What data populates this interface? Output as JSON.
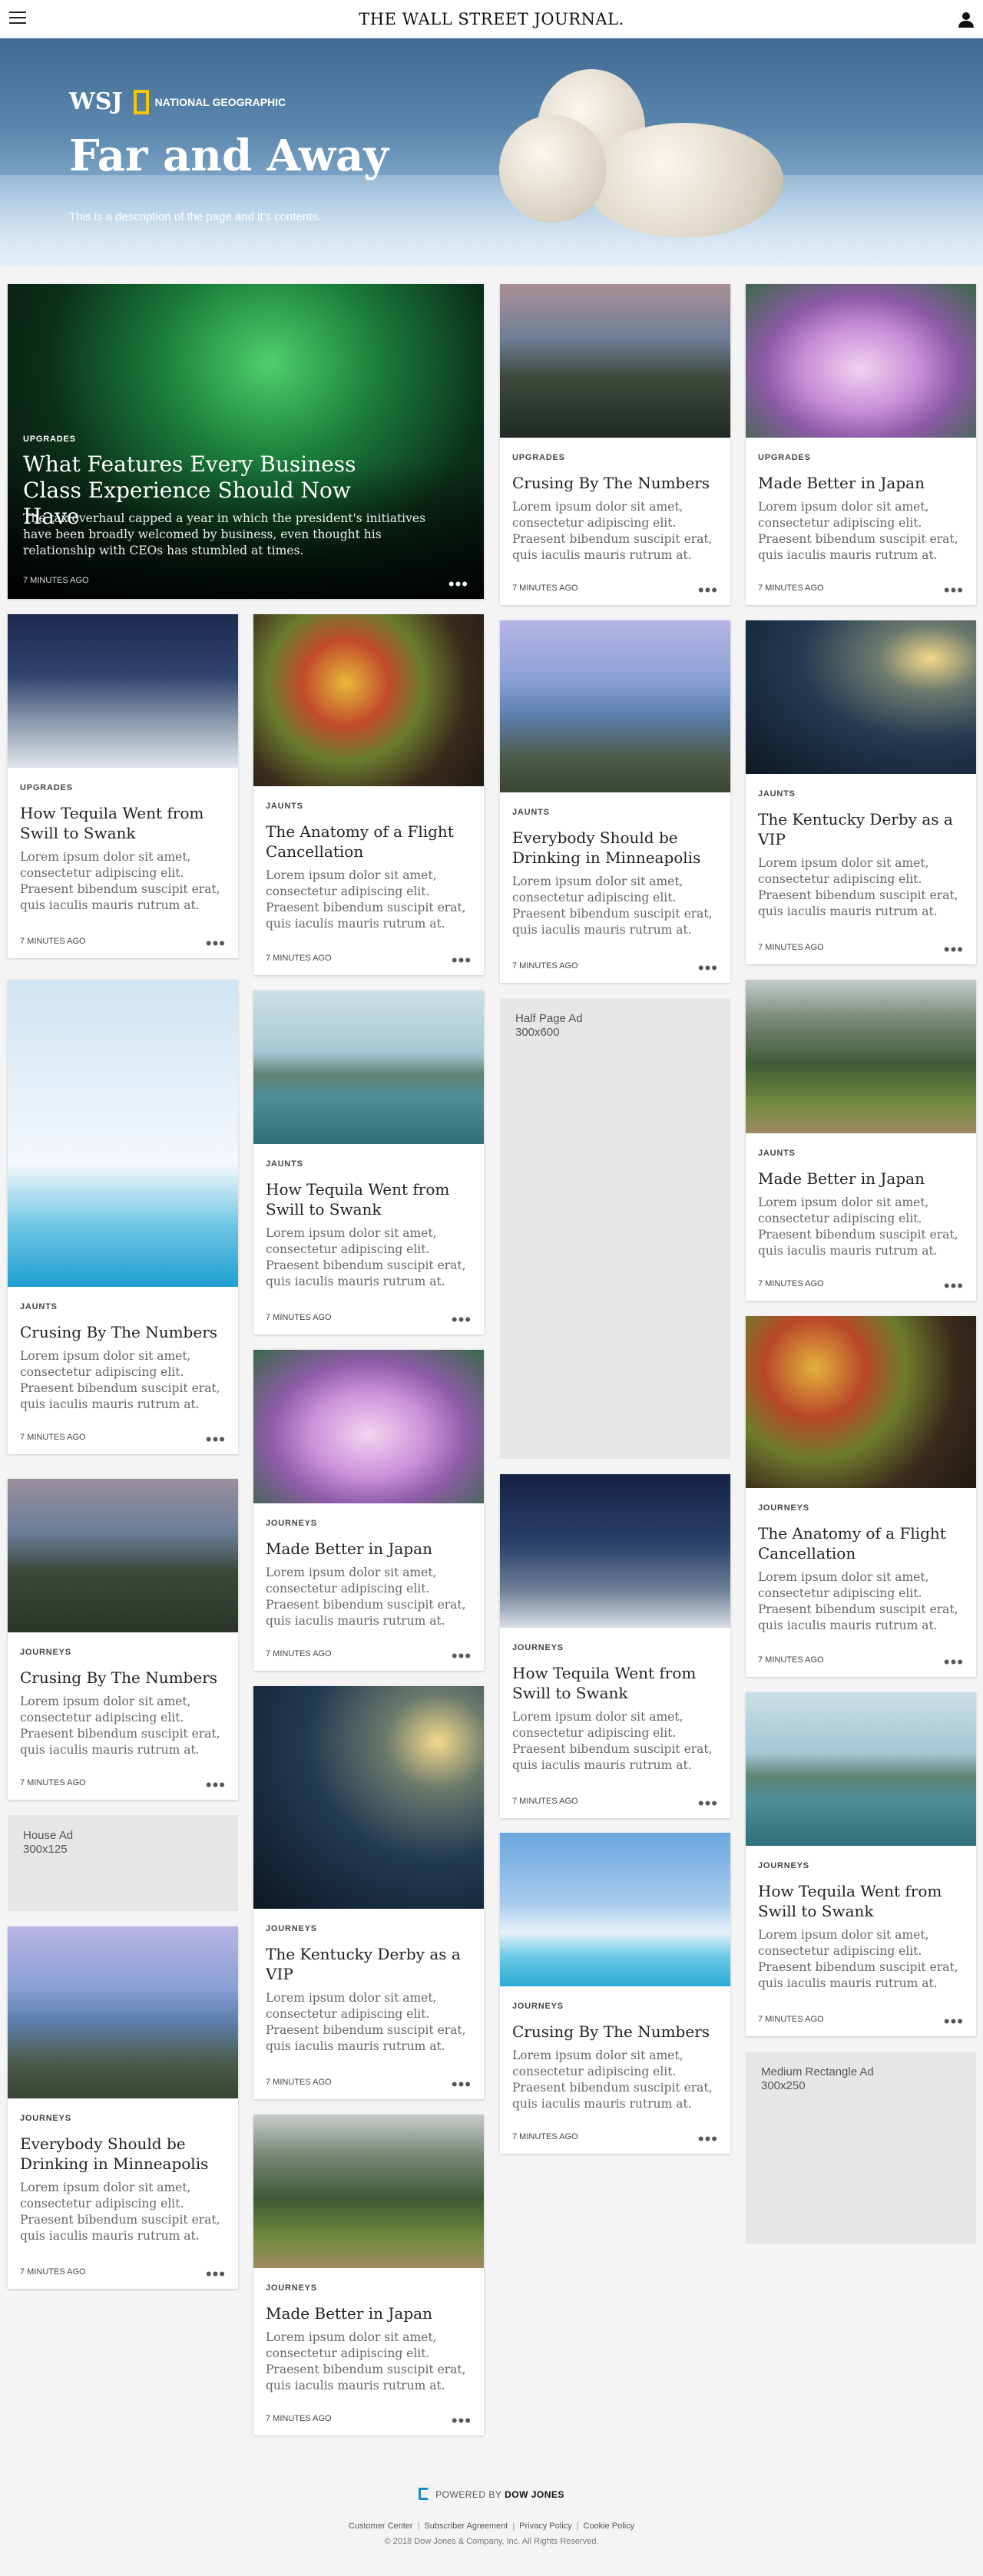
{
  "header": {
    "masthead": "THE WALL STREET JOURNAL."
  },
  "hero": {
    "brand_wsj": "WSJ",
    "brand_partner": "NATIONAL GEOGRAPHIC",
    "title": "Far and Away",
    "description": "This is a description of the page and it's contents."
  },
  "colors": {
    "natgeo_yellow": "#f7c800",
    "dowjones_blue": "#1a8cc9",
    "ad_gray": "#e6e6e6"
  },
  "feature": {
    "kicker": "UPGRADES",
    "title": "What Features Every Business Class Experience Should Now Have",
    "summary": "The tax overhaul capped a year in which the president's initiatives have been broadly welcomed by business, even thought his relationship with CEOs has stumbled at times.",
    "time": "7 MINUTES AGO",
    "more": "•••"
  },
  "lorem": "Lorem ipsum dolor sit amet, consectetur adipiscing elit. Praesent bibendum suscipit erat, quis iaculis mauris rutrum at.",
  "time": "7 MINUTES AGO",
  "more": "•••",
  "cards": [
    {
      "kicker": "UPGRADES",
      "title": "Crusing By The Numbers",
      "image": "cliff-coast"
    },
    {
      "kicker": "UPGRADES",
      "title": "Made Better in Japan",
      "image": "cherry-blossoms"
    },
    {
      "kicker": "UPGRADES",
      "title": "How Tequila Went from Swill to Swank",
      "image": "snowy-trees-night"
    },
    {
      "kicker": "JAUNTS",
      "title": "The Anatomy of a Flight Cancellation",
      "image": "spice-market"
    },
    {
      "kicker": "JAUNTS",
      "title": "Everybody Should be Drinking in Minneapolis",
      "image": "llamas"
    },
    {
      "kicker": "JAUNTS",
      "title": "The Kentucky Derby as a VIP",
      "image": "mountain-night"
    },
    {
      "kicker": "JAUNTS",
      "title": "Crusing By The Numbers",
      "image": "polar-bears"
    },
    {
      "kicker": "JAUNTS",
      "title": "How Tequila Went from Swill to Swank",
      "image": "ha-long-bay"
    },
    {
      "kicker": "JAUNTS",
      "title": "Made Better in Japan",
      "image": "green-valley"
    },
    {
      "kicker": "JOURNEYS",
      "title": "Made Better in Japan",
      "image": "cherry-blossoms"
    },
    {
      "kicker": "JOURNEYS",
      "title": "The Anatomy of a Flight Cancellation",
      "image": "spice-market"
    },
    {
      "kicker": "JOURNEYS",
      "title": "Crusing By The Numbers",
      "image": "cliff-coast"
    },
    {
      "kicker": "JOURNEYS",
      "title": "How Tequila Went from Swill to Swank",
      "image": "snowy-trees-night"
    },
    {
      "kicker": "JOURNEYS",
      "title": "How Tequila Went from Swill to Swank",
      "image": "ha-long-bay"
    },
    {
      "kicker": "JOURNEYS",
      "title": "The Kentucky Derby as a VIP",
      "image": "mountain-night"
    },
    {
      "kicker": "JOURNEYS",
      "title": "Everybody Should be Drinking in Minneapolis",
      "image": "llamas"
    },
    {
      "kicker": "JOURNEYS",
      "title": "Crusing By The Numbers",
      "image": "polar-bears-ice"
    },
    {
      "kicker": "JOURNEYS",
      "title": "Made Better in Japan",
      "image": "green-valley"
    }
  ],
  "ads": {
    "half_page": {
      "name": "Half Page Ad",
      "size": "300x600"
    },
    "house": {
      "name": "House Ad",
      "size": "300x125"
    },
    "medium_rect": {
      "name": "Medium Rectangle Ad",
      "size": "300x250"
    }
  },
  "footer": {
    "powered_prefix": "POWERED BY",
    "powered_brand": "DOW JONES",
    "links": [
      "Customer Center",
      "Subscriber Agreement",
      "Privacy Policy",
      "Cookie Policy"
    ],
    "copyright": "© 2018 Dow Jones & Company, Inc. All Rights Reserved."
  }
}
